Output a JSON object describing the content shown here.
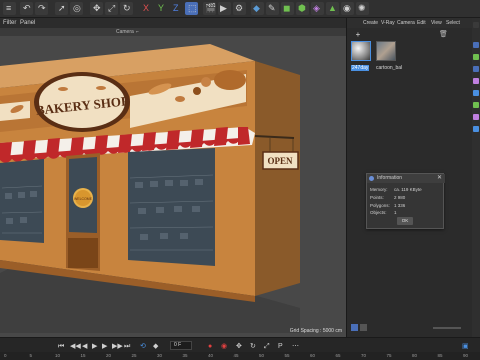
{
  "menu": {
    "filter": "Filter",
    "panel": "Panel"
  },
  "viewport": {
    "camera_label": "Camera",
    "grid_spacing": "Grid Spacing : 5000 cm"
  },
  "scene": {
    "bakery_sign": "BAKERY SHOP",
    "open_sign": "OPEN",
    "door_sign": "WELCOME"
  },
  "right_panel": {
    "menu": [
      "Create",
      "V-Ray",
      "Camera",
      "Edit",
      "View",
      "Select"
    ],
    "materials": [
      "247day",
      "cartoon_bal"
    ]
  },
  "dialog": {
    "title": "Information",
    "rows": [
      {
        "label": "Memory:",
        "value": "ca. 119 KByte"
      },
      {
        "label": "Points:",
        "value": "2 980"
      },
      {
        "label": "Polygons:",
        "value": "1 336"
      },
      {
        "label": "Objects:",
        "value": "1"
      }
    ],
    "ok_label": "OK"
  },
  "playback": {
    "frame": "0 F"
  },
  "timeline": {
    "ticks": [
      "0",
      "5",
      "10",
      "15",
      "20",
      "25",
      "30",
      "35",
      "40",
      "45",
      "50",
      "55",
      "60",
      "65",
      "70",
      "75",
      "80",
      "85",
      "90"
    ]
  },
  "colors": {
    "building": "#c8843e",
    "awning_red": "#c0282a",
    "sign_brown": "#5a2e14",
    "accent_blue": "#4a90e2"
  }
}
